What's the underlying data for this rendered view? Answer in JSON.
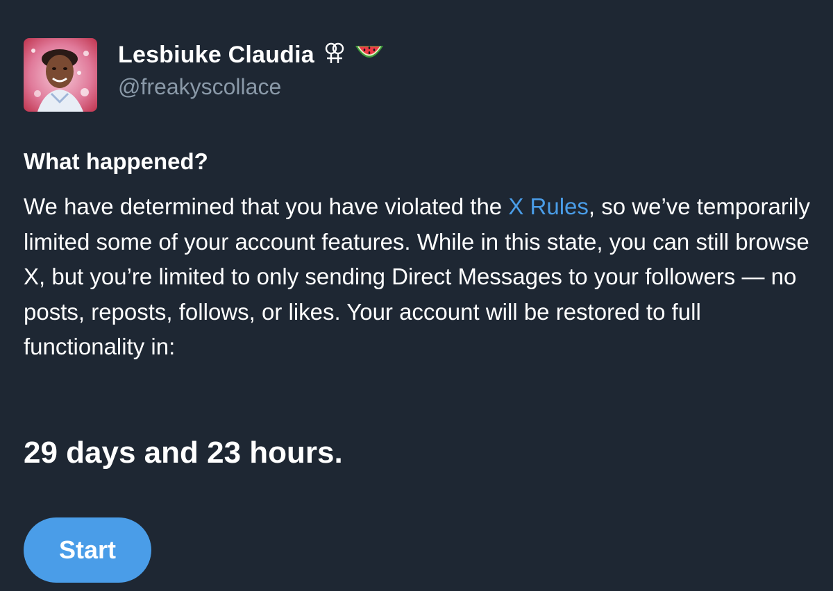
{
  "profile": {
    "display_name": "Lesbiuke Claudia",
    "handle": "@freakyscollace",
    "name_icons": [
      "double-female-symbol-icon",
      "watermelon-icon"
    ]
  },
  "notice": {
    "heading": "What happened?",
    "text_before_link": "We have determined that you have violated the ",
    "link_text": "X Rules",
    "text_after_link": ", so we’ve temporarily limited some of your account features. While in this state, you can still browse X, but you’re limited to only sending Direct Messages to your followers — no posts, reposts, follows, or likes. Your account will be restored to full functionality in:",
    "countdown": "29 days and 23 hours."
  },
  "actions": {
    "start_label": "Start"
  },
  "colors": {
    "background": "#1e2733",
    "text": "#ffffff",
    "secondary_text": "#8a99a8",
    "accent": "#4a9de8"
  }
}
